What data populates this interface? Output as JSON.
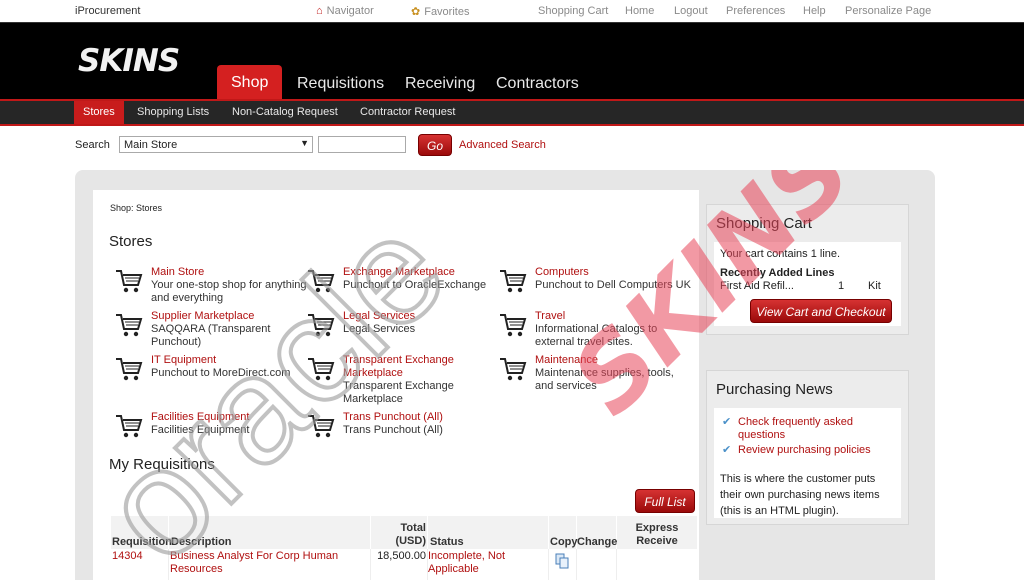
{
  "app": {
    "brand": "iProcurement",
    "top_links": [
      "Navigator",
      "Favorites",
      "Shopping Cart",
      "Home",
      "Logout",
      "Preferences",
      "Help",
      "Personalize Page"
    ],
    "logo_text": "SKINS",
    "main_tabs": [
      "Shop",
      "Requisitions",
      "Receiving",
      "Contractors"
    ],
    "sub_tabs": [
      "Stores",
      "Shopping Lists",
      "Non-Catalog Request",
      "Contractor Request"
    ]
  },
  "search": {
    "label": "Search",
    "selected_store": "Main Store",
    "query": "",
    "go_label": "Go",
    "advanced_label": "Advanced Search"
  },
  "breadcrumb": "Shop: Stores",
  "stores_heading": "Stores",
  "stores": [
    {
      "name": "Main Store",
      "desc": "Your one-stop shop for anything and everything"
    },
    {
      "name": "Exchange Marketplace",
      "desc": "Punchout to OracleExchange"
    },
    {
      "name": "Computers",
      "desc": "Punchout to Dell Computers UK"
    },
    {
      "name": "Supplier Marketplace",
      "desc": "SAQQARA (Transparent Punchout)"
    },
    {
      "name": "Legal Services",
      "desc": "Legal Services"
    },
    {
      "name": "Travel",
      "desc": "Informational Catalogs to external travel sites."
    },
    {
      "name": "IT Equipment",
      "desc": "Punchout to MoreDirect.com"
    },
    {
      "name": "Transparent Exchange Marketplace",
      "desc": "Transparent Exchange Marketplace"
    },
    {
      "name": "Maintenance",
      "desc": "Maintenance supplies, tools, and services"
    },
    {
      "name": "Facilities Equipment",
      "desc": "Facilities Equipment"
    },
    {
      "name": "Trans Punchout (All)",
      "desc": "Trans Punchout (All)"
    }
  ],
  "requisitions": {
    "heading": "My Requisitions",
    "full_list_label": "Full List",
    "columns": [
      "Requisition",
      "Description",
      "Total (USD)",
      "Status",
      "Copy",
      "Change",
      "Express Receive"
    ],
    "rows": [
      {
        "requisition": "14304",
        "description": "Business Analyst For Corp Human Resources",
        "total": "18,500.00",
        "status": "Incomplete, Not Applicable"
      }
    ]
  },
  "cart_panel": {
    "title": "Shopping Cart",
    "summary": "Your cart contains 1 line.",
    "recent_heading": "Recently Added Lines",
    "line_item": "First Aid Refil...",
    "line_qty": "1",
    "line_uom": "Kit",
    "checkout_label": "View Cart and Checkout"
  },
  "news_panel": {
    "title": "Purchasing News",
    "links": [
      "Check frequently asked questions",
      "Review purchasing policies"
    ],
    "body": "This is where the customer puts their own purchasing news items (this is an HTML plugin)."
  },
  "watermark": {
    "oracle": "oracle",
    "skins": "SKINS"
  },
  "colors": {
    "accent": "#c81c1c",
    "link": "#b01010",
    "header_bg": "#000000"
  }
}
